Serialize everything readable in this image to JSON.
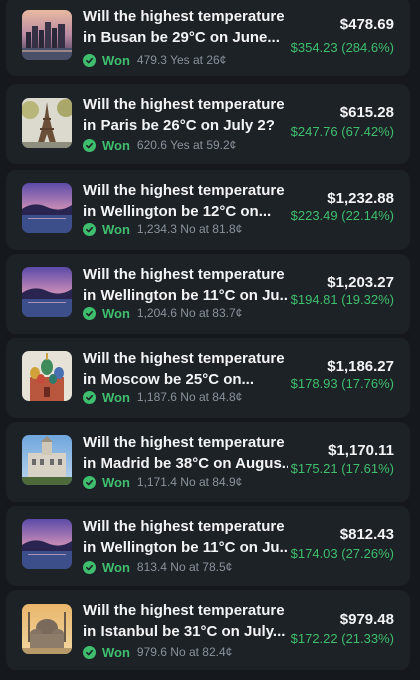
{
  "colors": {
    "background": "#15191d",
    "card": "#1d2227",
    "text": "#f2f4f6",
    "muted": "#8a929b",
    "win_green": "#3fbf6e"
  },
  "positions": [
    {
      "title_line1": "Will the highest temperature",
      "title_line2": "in Busan be 29°C on June...",
      "status": "Won",
      "status_icon": "check-circle-icon",
      "detail": "479.3 Yes at 26¢",
      "value": "$478.69",
      "pnl": "$354.23 (284.6%)",
      "thumbnail": "busan-city-image"
    },
    {
      "title_line1": "Will the highest temperature",
      "title_line2": "in Paris be 26°C on July 2?",
      "status": "Won",
      "status_icon": "check-circle-icon",
      "detail": "620.6 Yes at 59.2¢",
      "value": "$615.28",
      "pnl": "$247.76 (67.42%)",
      "thumbnail": "paris-eiffel-tower-image"
    },
    {
      "title_line1": "Will the highest temperature",
      "title_line2": "in Wellington be 12°C on...",
      "status": "Won",
      "status_icon": "check-circle-icon",
      "detail": "1,234.3 No at 81.8¢",
      "value": "$1,232.88",
      "pnl": "$223.49 (22.14%)",
      "thumbnail": "wellington-harbor-image"
    },
    {
      "title_line1": "Will the highest temperature",
      "title_line2": "in Wellington be 11°C on Ju...",
      "status": "Won",
      "status_icon": "check-circle-icon",
      "detail": "1,204.6 No at 83.7¢",
      "value": "$1,203.27",
      "pnl": "$194.81 (19.32%)",
      "thumbnail": "wellington-harbor-image"
    },
    {
      "title_line1": "Will the highest temperature",
      "title_line2": "in Moscow be 25°C on...",
      "status": "Won",
      "status_icon": "check-circle-icon",
      "detail": "1,187.6 No at 84.8¢",
      "value": "$1,186.27",
      "pnl": "$178.93 (17.76%)",
      "thumbnail": "moscow-cathedral-image"
    },
    {
      "title_line1": "Will the highest temperature",
      "title_line2": "in Madrid be 38°C on Augus...",
      "status": "Won",
      "status_icon": "check-circle-icon",
      "detail": "1,171.4 No at 84.9¢",
      "value": "$1,170.11",
      "pnl": "$175.21 (17.61%)",
      "thumbnail": "madrid-building-image"
    },
    {
      "title_line1": "Will the highest temperature",
      "title_line2": "in Wellington be 11°C on Ju...",
      "status": "Won",
      "status_icon": "check-circle-icon",
      "detail": "813.4 No at 78.5¢",
      "value": "$812.43",
      "pnl": "$174.03 (27.26%)",
      "thumbnail": "wellington-harbor-image"
    },
    {
      "title_line1": "Will the highest temperature",
      "title_line2": "in Istanbul be 31°C on July...",
      "status": "Won",
      "status_icon": "check-circle-icon",
      "detail": "979.6 No at 82.4¢",
      "value": "$979.48",
      "pnl": "$172.22 (21.33%)",
      "thumbnail": "istanbul-mosque-image"
    }
  ]
}
